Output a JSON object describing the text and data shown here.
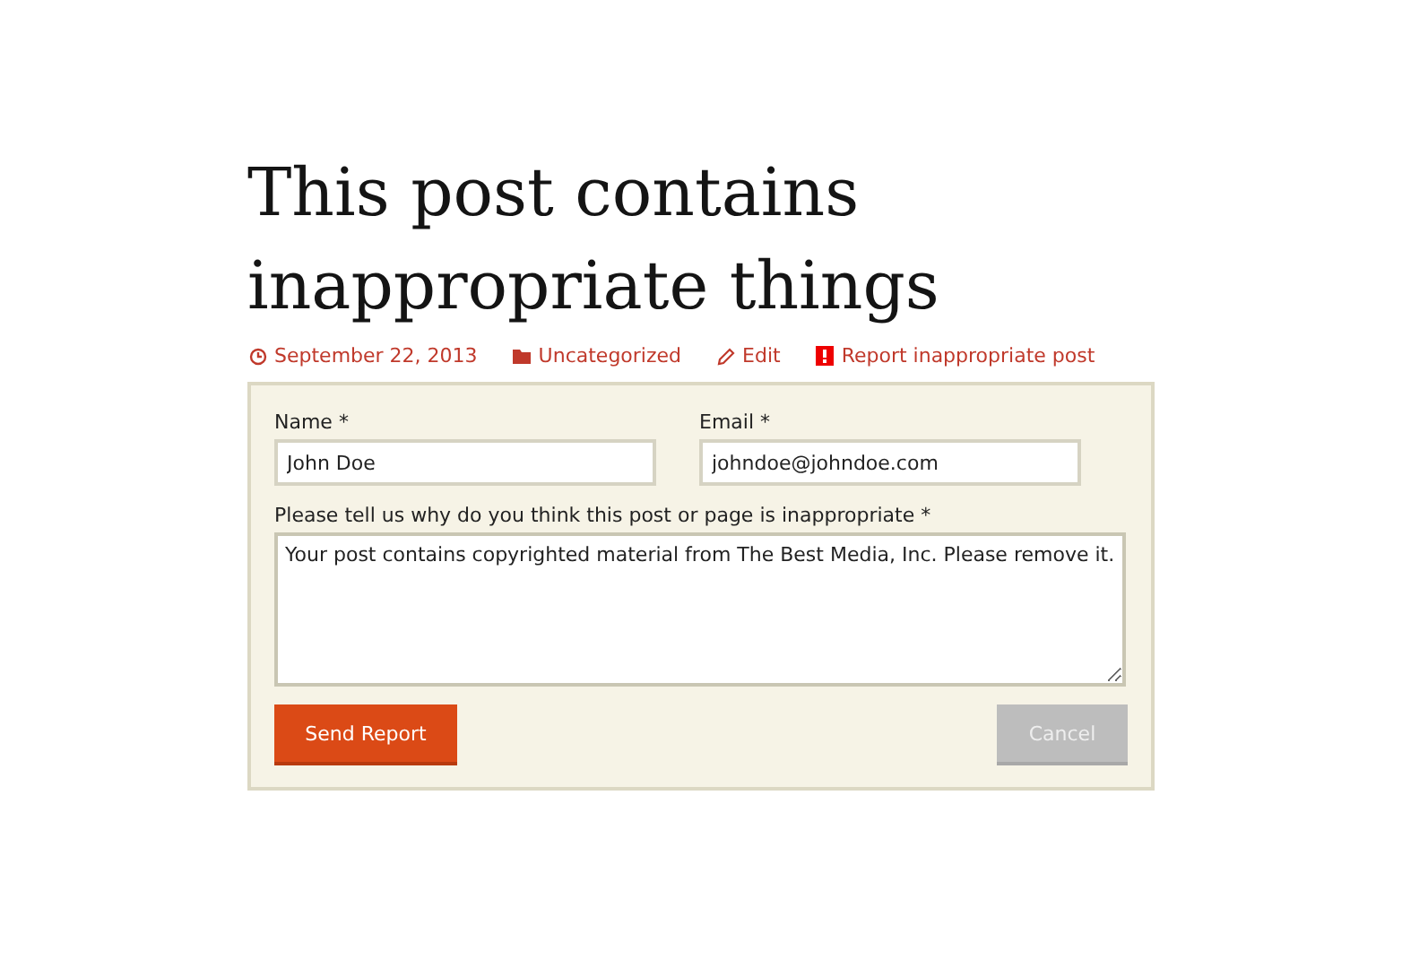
{
  "title": "This post contains inappropriate things",
  "meta": [
    {
      "kind": "date",
      "label": "September 22, 2013"
    },
    {
      "kind": "category",
      "label": "Uncategorized"
    },
    {
      "kind": "edit",
      "label": "Edit"
    },
    {
      "kind": "report",
      "label": "Report inappropriate post"
    }
  ],
  "form": {
    "name": {
      "label": "Name *",
      "value": "John Doe"
    },
    "email": {
      "label": "Email *",
      "value": "johndoe@johndoe.com"
    },
    "reason": {
      "label": "Please tell us why do you think this post or page is inappropriate *",
      "value": "Your post contains copyrighted material from The Best Media, Inc. Please remove it."
    },
    "buttons": [
      {
        "kind": "primary",
        "label": "Send Report"
      },
      {
        "kind": "secondary",
        "label": "Cancel"
      }
    ]
  }
}
